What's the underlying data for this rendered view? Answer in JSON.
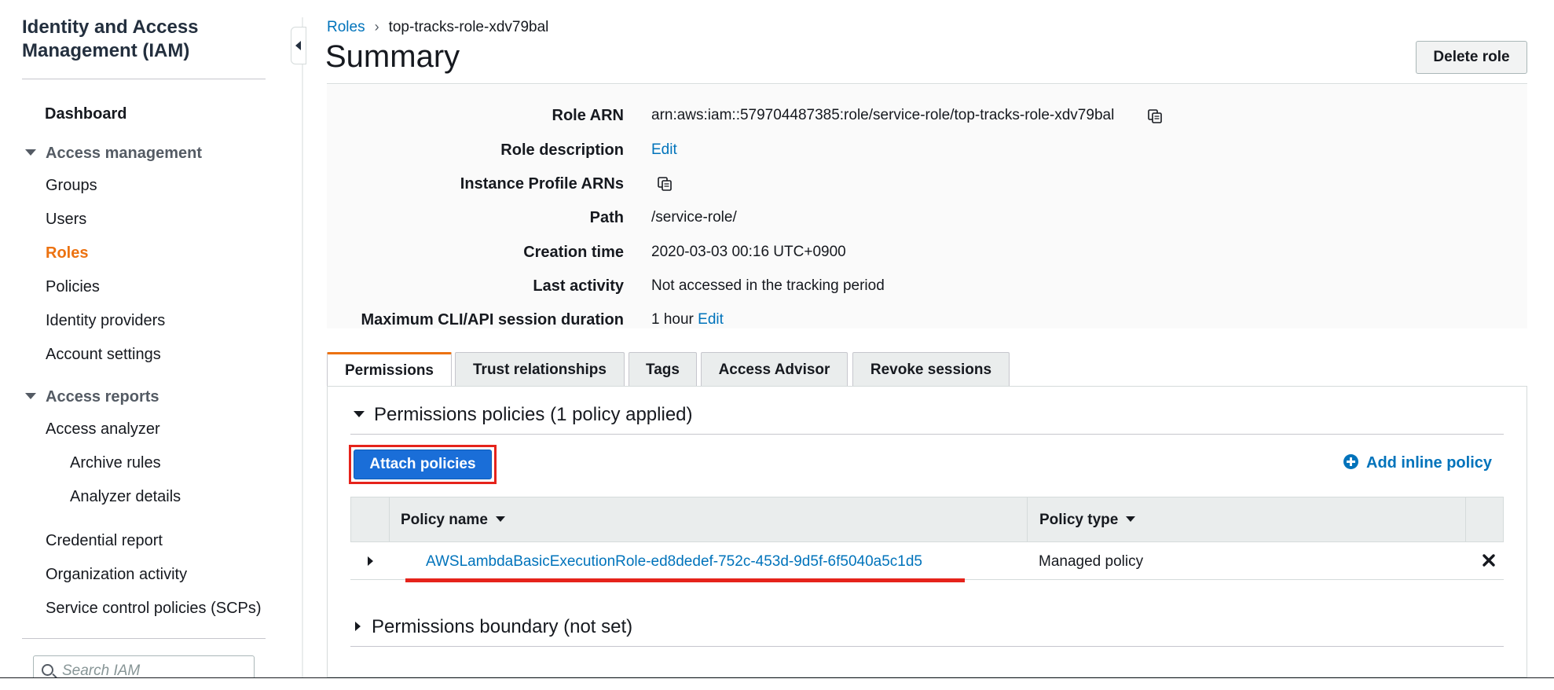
{
  "sidebar": {
    "title": "Identity and Access Management (IAM)",
    "dashboard": "Dashboard",
    "access_management": {
      "label": "Access management",
      "items": [
        "Groups",
        "Users",
        "Roles",
        "Policies",
        "Identity providers",
        "Account settings"
      ]
    },
    "access_reports": {
      "label": "Access reports",
      "items": [
        "Access analyzer",
        "Archive rules",
        "Analyzer details",
        "Credential report",
        "Organization activity",
        "Service control policies (SCPs)"
      ]
    },
    "search_placeholder": "Search IAM"
  },
  "breadcrumb": {
    "root": "Roles",
    "current": "top-tracks-role-xdv79bal"
  },
  "header": {
    "title": "Summary",
    "delete_button": "Delete role"
  },
  "summary": {
    "role_arn": {
      "label": "Role ARN",
      "value": "arn:aws:iam::579704487385:role/service-role/top-tracks-role-xdv79bal"
    },
    "role_description": {
      "label": "Role description",
      "action": "Edit"
    },
    "instance_profile_arns": {
      "label": "Instance Profile ARNs"
    },
    "path": {
      "label": "Path",
      "value": "/service-role/"
    },
    "creation_time": {
      "label": "Creation time",
      "value": "2020-03-03 00:16 UTC+0900"
    },
    "last_activity": {
      "label": "Last activity",
      "value": "Not accessed in the tracking period"
    },
    "max_session": {
      "label": "Maximum CLI/API session duration",
      "value": "1 hour",
      "action": "Edit"
    }
  },
  "tabs": [
    "Permissions",
    "Trust relationships",
    "Tags",
    "Access Advisor",
    "Revoke sessions"
  ],
  "permissions": {
    "policies_heading": "Permissions policies (1 policy applied)",
    "attach_button": "Attach policies",
    "add_inline": "Add inline policy",
    "columns": [
      "Policy name",
      "Policy type"
    ],
    "rows": [
      {
        "name": "AWSLambdaBasicExecutionRole-ed8dedef-752c-453d-9d5f-6f5040a5c1d5",
        "type": "Managed policy"
      }
    ],
    "boundary_heading": "Permissions boundary (not set)"
  },
  "colors": {
    "accent": "#ec7211",
    "link": "#0073bb",
    "primary_button": "#1a6ed8",
    "highlight": "#e5231b"
  },
  "icons": [
    "copy-icon",
    "search-icon",
    "plus-circle-icon",
    "close-icon",
    "caret-down-icon",
    "caret-right-icon"
  ]
}
